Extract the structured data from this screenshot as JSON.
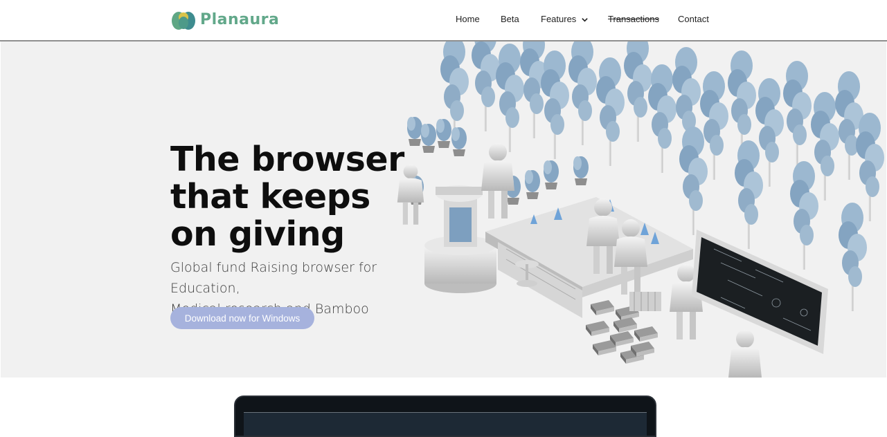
{
  "brand": {
    "name": "Planaura",
    "logo_icon": "lotus-logo-icon",
    "colors": {
      "green": "#62a88a",
      "teal": "#3e8c8f",
      "yellow": "#d8c34a"
    }
  },
  "nav": {
    "items": [
      {
        "label": "Home"
      },
      {
        "label": "Beta"
      },
      {
        "label": "Features",
        "icon": "chevron-down-icon"
      },
      {
        "label": "Transactions",
        "strikethrough": true
      },
      {
        "label": "Contact"
      }
    ]
  },
  "hero": {
    "title_lines": [
      "The browser",
      "that keeps",
      "on giving"
    ],
    "subtitle_lines": [
      "Global fund Raising browser for Education,",
      "Medical research and Bamboo"
    ],
    "cta_label": "Download now for Windows",
    "cta_color": "#a6b2dd",
    "background": "#f1f1f1",
    "illustration": "3d-figures-bamboo-lab-scene"
  },
  "device_preview": {
    "icon": "laptop-device-icon"
  }
}
